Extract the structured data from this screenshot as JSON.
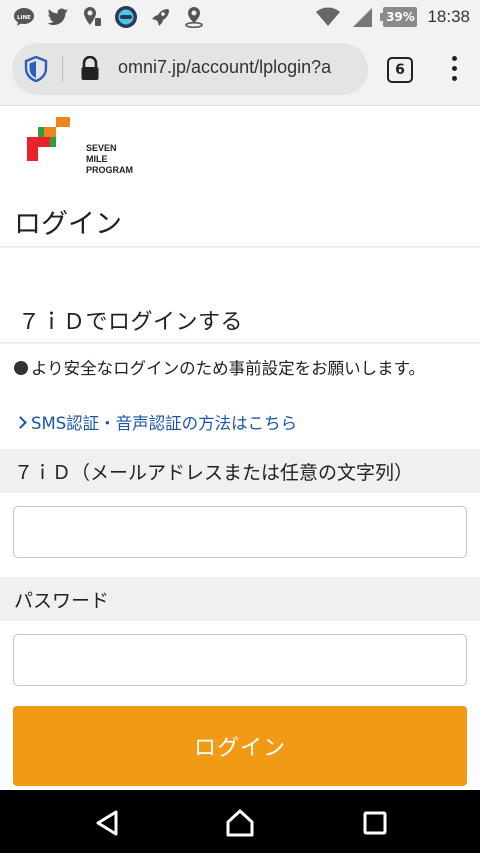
{
  "status_bar": {
    "time": "18:38",
    "battery": "39%",
    "left_icons": [
      "line-icon",
      "twitter-icon",
      "location-pin-icon",
      "app-badge-icon",
      "rocket-icon",
      "map-marker-icon"
    ],
    "right_icons": [
      "wifi-icon",
      "signal-icon",
      "battery-icon"
    ]
  },
  "browser": {
    "url": "omni7.jp/account/lplogin?a",
    "tab_count": "6"
  },
  "logo": {
    "line1": "SEVEN MILE",
    "line2": "PROGRAM",
    "colors": [
      "#e8232a",
      "#2f9e3f",
      "#f0841c"
    ]
  },
  "page": {
    "title": "ログイン",
    "section_heading": "７ｉＤでログインする",
    "notice": "より安全なログインのため事前設定をお願いします。",
    "sms_link": "SMS認証・音声認証の方法はこちら",
    "id_label": "７ｉＤ（メールアドレスまたは任意の文字列）",
    "id_value": "",
    "password_label": "パスワード",
    "password_value": "",
    "login_button": "ログイン"
  },
  "colors": {
    "accent": "#f09a16",
    "link": "#1a56a8",
    "label_bg": "#f0f0f0"
  }
}
